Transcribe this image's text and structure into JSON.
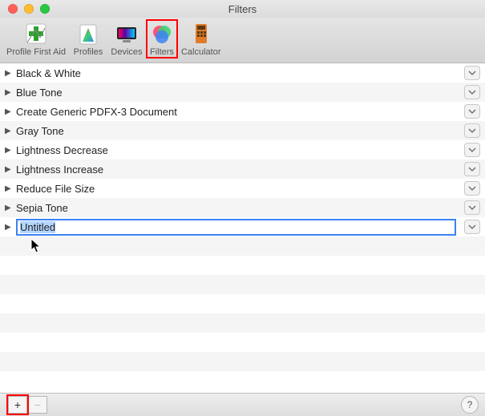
{
  "window": {
    "title": "Filters"
  },
  "toolbar": {
    "items": [
      {
        "id": "profile-first-aid",
        "label": "Profile First Aid"
      },
      {
        "id": "profiles",
        "label": "Profiles"
      },
      {
        "id": "devices",
        "label": "Devices"
      },
      {
        "id": "filters",
        "label": "Filters",
        "selected": true
      },
      {
        "id": "calculator",
        "label": "Calculator"
      }
    ]
  },
  "filters": {
    "items": [
      {
        "label": "Black & White"
      },
      {
        "label": "Blue Tone"
      },
      {
        "label": "Create Generic PDFX-3 Document"
      },
      {
        "label": "Gray Tone"
      },
      {
        "label": "Lightness Decrease"
      },
      {
        "label": "Lightness Increase"
      },
      {
        "label": "Reduce File Size"
      },
      {
        "label": "Sepia Tone"
      }
    ],
    "editing": {
      "value": "Untitled"
    }
  },
  "footer": {
    "add_label": "+",
    "remove_label": "−",
    "help_label": "?"
  },
  "colors": {
    "highlight_red": "#ff0000",
    "selection_blue": "#3b82f6"
  }
}
